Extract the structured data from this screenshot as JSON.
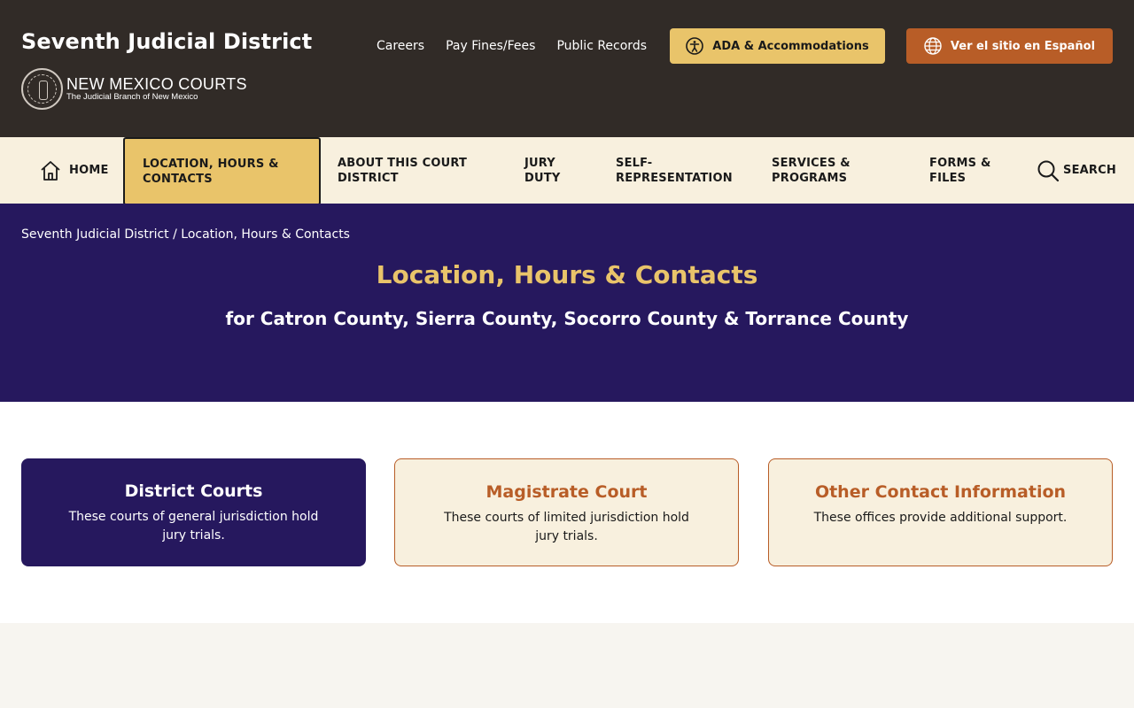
{
  "header": {
    "site_title": "Seventh Judicial District",
    "brand_name": "NEW MEXICO COURTS",
    "brand_tagline": "The Judicial Branch of New Mexico",
    "util_links": [
      "Careers",
      "Pay Fines/Fees",
      "Public Records"
    ],
    "ada_button": "ADA & Accommodations",
    "spanish_button": "Ver el sitio en Español"
  },
  "nav": {
    "home": "HOME",
    "location": "LOCATION, HOURS & CONTACTS",
    "about": "ABOUT THIS COURT DISTRICT",
    "jury": "JURY DUTY",
    "self": "SELF-REPRESENTATION",
    "services": "SERVICES & PROGRAMS",
    "forms": "FORMS & FILES",
    "search": "SEARCH"
  },
  "hero": {
    "breadcrumb": "Seventh Judicial District / Location, Hours & Contacts",
    "title": "Location, Hours & Contacts",
    "subtitle": "for Catron County, Sierra County, Socorro County & Torrance County"
  },
  "cards": [
    {
      "title": "District Courts",
      "text": "These courts of general jurisdiction hold jury trials."
    },
    {
      "title": "Magistrate Court",
      "text": "These courts of limited jurisdiction hold jury trials."
    },
    {
      "title": "Other Contact Information",
      "text": "These offices provide additional support."
    }
  ],
  "colors": {
    "header_bg": "#312b27",
    "nav_bg": "#f8f0de",
    "accent_gold": "#e9c46a",
    "accent_rust": "#b85d27",
    "hero_bg": "#26185e"
  },
  "icons": [
    "home-icon",
    "accessibility-icon",
    "globe-icon",
    "search-icon",
    "court-seal-logo"
  ]
}
